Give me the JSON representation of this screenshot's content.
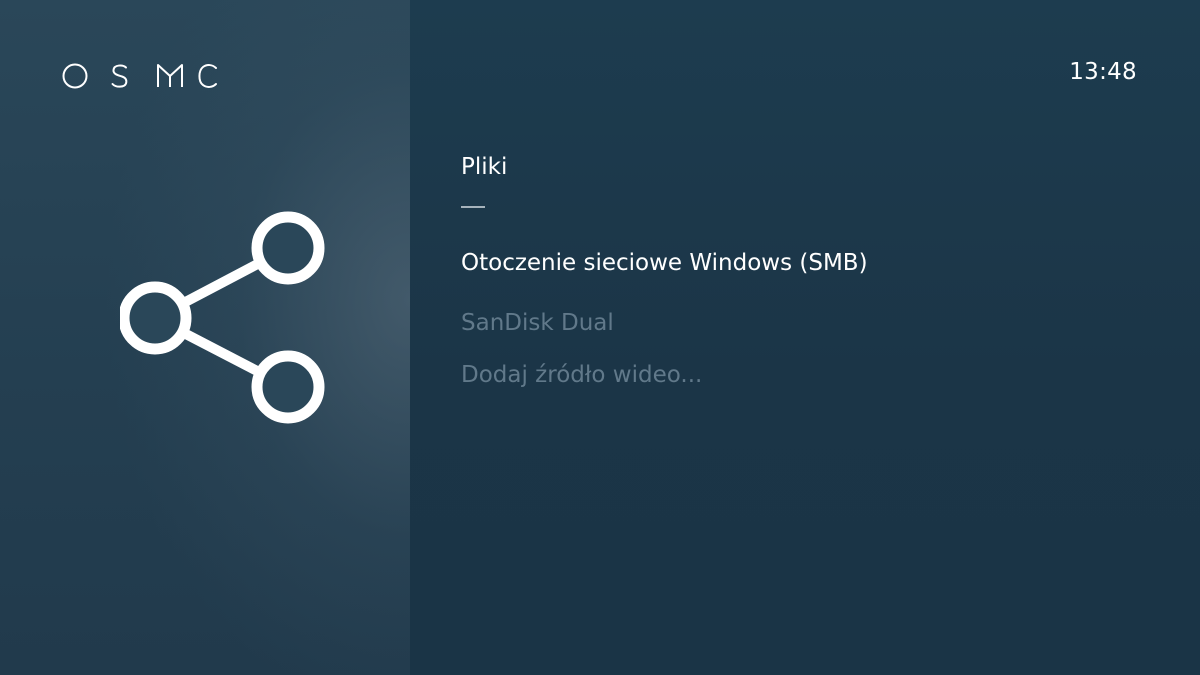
{
  "brand": {
    "logo_text": "OSMC",
    "logo_color": "#ffffff"
  },
  "header": {
    "clock": "13:48"
  },
  "section": {
    "title": "Pliki",
    "icon": "share-icon"
  },
  "menu": {
    "items": [
      {
        "label": "Otoczenie sieciowe Windows (SMB)",
        "state": "focused"
      },
      {
        "label": "SanDisk Dual",
        "state": "normal"
      },
      {
        "label": "Dodaj źródło wideo...",
        "state": "normal"
      }
    ]
  },
  "colors": {
    "background": "#1c3547",
    "left_panel": "#2a4759",
    "text_focused": "#ffffff",
    "text_dimmed": "#61798a"
  }
}
